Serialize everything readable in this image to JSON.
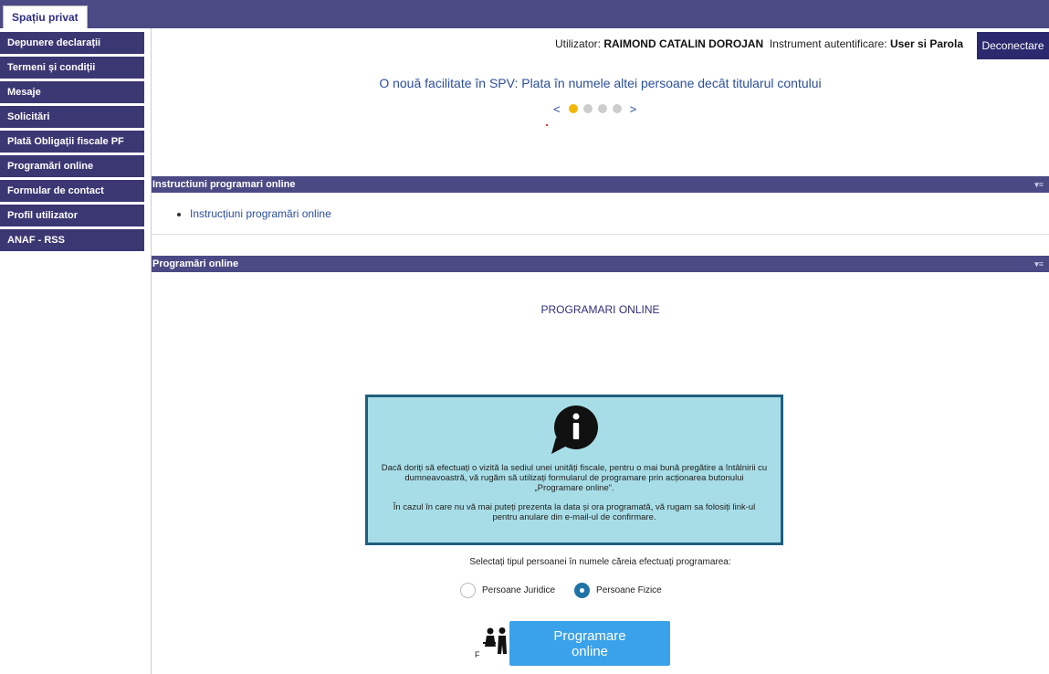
{
  "header": {
    "tab_label": "Spațiu privat"
  },
  "sidebar": {
    "items": [
      {
        "label": "Depunere declarații"
      },
      {
        "label": "Termeni și condiții"
      },
      {
        "label": "Mesaje"
      },
      {
        "label": "Solicitări"
      },
      {
        "label": "Plată Obligații fiscale PF"
      },
      {
        "label": "Programări online"
      },
      {
        "label": "Formular de contact"
      },
      {
        "label": "Profil utilizator"
      },
      {
        "label": "ANAF - RSS"
      }
    ]
  },
  "user": {
    "user_prefix": "Utilizator:",
    "user_name": "RAIMOND CATALIN DOROJAN",
    "auth_prefix": "Instrument autentificare:",
    "auth_method": "User si Parola",
    "logout_label": "Deconectare"
  },
  "announcement": {
    "text": "O nouă facilitate în SPV: Plata în numele altei persoane decât titularul contului",
    "prev": "<",
    "next": ">",
    "active_index": 0,
    "total": 4
  },
  "instructions_panel": {
    "title": "Instructiuni programari online",
    "link": "Instrucțiuni programări online"
  },
  "programari_panel": {
    "title": "Programări online",
    "heading": "PROGRAMARI ONLINE",
    "info_para1": "Dacă doriți să efectuați o vizită la sediul unei unități fiscale, pentru o mai bună pregătire a întâlnirii cu dumneavoastră, vă rugăm să utilizați formularul de programare prin acționarea butonului „Programare online”.",
    "info_para2": "În cazul în care nu vă mai puteți prezenta la data și ora programată, vă rugam sa folosiți link-ul pentru anulare din e-mail-ul de confirmare.",
    "select_label": "Selectați tipul persoanei în numele căreia efectuați programarea:",
    "options": [
      {
        "label": "Persoane Juridice",
        "selected": false
      },
      {
        "label": "Persoane Fizice",
        "selected": true
      }
    ],
    "button_line1": "Programare",
    "button_line2": "online",
    "icon_letter": "F"
  },
  "colors": {
    "nav": "#3b3773",
    "topbar": "#4b4a84",
    "button": "#3aa2ea",
    "info_bg": "#a7dde6"
  },
  "icons": [
    "info-bubble-icon",
    "people-icon",
    "panel-toggle-icon"
  ]
}
